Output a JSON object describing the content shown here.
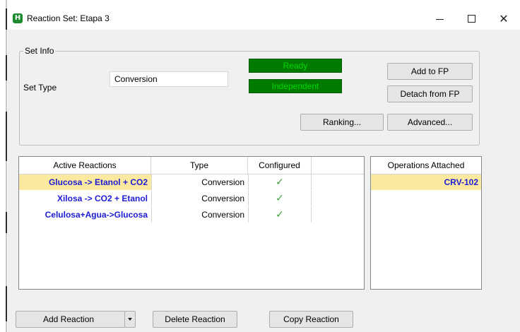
{
  "window": {
    "title": "Reaction Set: Etapa 3",
    "app_icon_letter": "H",
    "app_icon_color": "#1c8a2e"
  },
  "set_info": {
    "group_title": "Set Info",
    "set_type_label": "Set Type",
    "set_type_value": "Conversion",
    "status_ready": "Ready",
    "status_independent": "Independent",
    "status_color": "#007b00"
  },
  "buttons": {
    "add_to_fp": "Add to FP",
    "detach_from_fp": "Detach from FP",
    "ranking": "Ranking...",
    "advanced": "Advanced...",
    "add_reaction": "Add Reaction",
    "delete_reaction": "Delete Reaction",
    "copy_reaction": "Copy Reaction"
  },
  "reactions_table": {
    "columns": [
      "Active Reactions",
      "Type",
      "Configured",
      ""
    ],
    "rows": [
      {
        "name": "Glucosa -> Etanol + CO2",
        "type": "Conversion",
        "configured": "✓"
      },
      {
        "name": "Xilosa -> CO2 + Etanol",
        "type": "Conversion",
        "configured": "✓"
      },
      {
        "name": "Celulosa+Agua->Glucosa",
        "type": "Conversion",
        "configured": "✓"
      }
    ]
  },
  "operations": {
    "header": "Operations Attached",
    "items": [
      "CRV-102"
    ]
  },
  "icons": {
    "close": "close-icon",
    "maximize": "maximize-icon",
    "minimize": "minimize-icon",
    "check": "check-icon",
    "dropdown": "chevron-down-icon"
  },
  "highlight_color": "#fbe99f",
  "link_color": "#1c1cd6"
}
